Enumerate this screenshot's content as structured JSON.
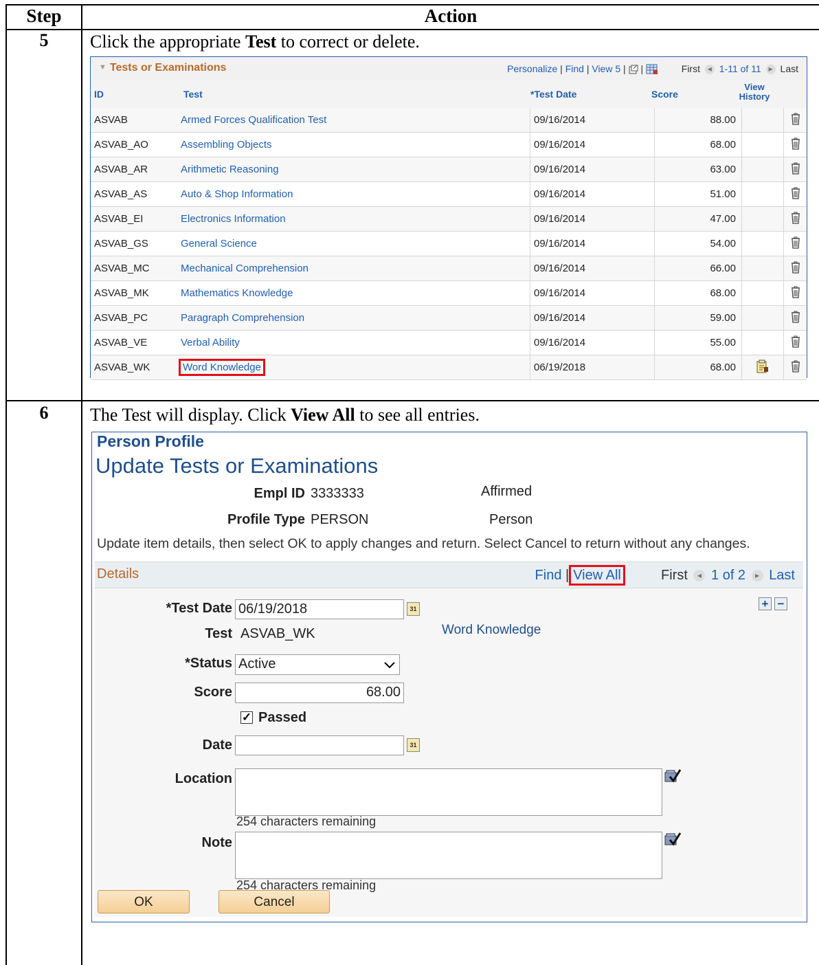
{
  "table": {
    "header_step": "Step",
    "header_action": "Action",
    "step5": {
      "number": "5",
      "instruction_pre": "Click the appropriate ",
      "instruction_bold": "Test",
      "instruction_post": " to correct or delete."
    },
    "step6": {
      "number": "6",
      "instruction_pre": "The Test will display. Click ",
      "instruction_bold": "View All",
      "instruction_post": " to see all entries."
    }
  },
  "grid": {
    "title": "Tests or Examinations",
    "nav": {
      "personalize": "Personalize",
      "find": "Find",
      "view": "View 5",
      "first": "First",
      "range": "1-11 of 11",
      "last": "Last"
    },
    "columns": {
      "id": "ID",
      "test": "Test",
      "date": "*Test Date",
      "score": "Score",
      "history": "View History"
    },
    "rows": [
      {
        "id": "ASVAB",
        "test": "Armed Forces Qualification Test",
        "date": "09/16/2014",
        "score": "88.00",
        "history": false
      },
      {
        "id": "ASVAB_AO",
        "test": "Assembling Objects",
        "date": "09/16/2014",
        "score": "68.00",
        "history": false
      },
      {
        "id": "ASVAB_AR",
        "test": "Arithmetic Reasoning",
        "date": "09/16/2014",
        "score": "63.00",
        "history": false
      },
      {
        "id": "ASVAB_AS",
        "test": "Auto & Shop Information",
        "date": "09/16/2014",
        "score": "51.00",
        "history": false
      },
      {
        "id": "ASVAB_EI",
        "test": "Electronics Information",
        "date": "09/16/2014",
        "score": "47.00",
        "history": false
      },
      {
        "id": "ASVAB_GS",
        "test": "General Science",
        "date": "09/16/2014",
        "score": "54.00",
        "history": false
      },
      {
        "id": "ASVAB_MC",
        "test": "Mechanical Comprehension",
        "date": "09/16/2014",
        "score": "66.00",
        "history": false
      },
      {
        "id": "ASVAB_MK",
        "test": "Mathematics Knowledge",
        "date": "09/16/2014",
        "score": "68.00",
        "history": false
      },
      {
        "id": "ASVAB_PC",
        "test": "Paragraph Comprehension",
        "date": "09/16/2014",
        "score": "59.00",
        "history": false
      },
      {
        "id": "ASVAB_VE",
        "test": "Verbal Ability",
        "date": "09/16/2014",
        "score": "55.00",
        "history": false
      },
      {
        "id": "ASVAB_WK",
        "test": "Word Knowledge",
        "date": "06/19/2018",
        "score": "68.00",
        "history": true,
        "highlighted": true
      }
    ]
  },
  "form": {
    "breadcrumb": "Person Profile",
    "title": "Update Tests or Examinations",
    "empl_id_label": "Empl ID",
    "empl_id_value": "3333333",
    "empl_status": "Affirmed",
    "profile_type_label": "Profile Type",
    "profile_type_value": "PERSON",
    "profile_type_desc": "Person",
    "description": "Update item details, then select OK to apply changes and return. Select Cancel to return without any changes.",
    "details": {
      "title": "Details",
      "find": "Find",
      "view_all": "View All",
      "first": "First",
      "range": "1 of 2",
      "last": "Last"
    },
    "fields": {
      "test_date_label": "*Test Date",
      "test_date_value": "06/19/2018",
      "test_label": "Test",
      "test_value": "ASVAB_WK",
      "test_desc": "Word Knowledge",
      "status_label": "*Status",
      "status_value": "Active",
      "score_label": "Score",
      "score_value": "68.00",
      "passed_label": "Passed",
      "passed_checked": true,
      "date_label": "Date",
      "date_value": "",
      "location_label": "Location",
      "location_value": "",
      "location_remaining": "254 characters remaining",
      "note_label": "Note",
      "note_value": "",
      "note_remaining": "254 characters remaining"
    },
    "buttons": {
      "ok": "OK",
      "cancel": "Cancel"
    }
  },
  "colors": {
    "link": "#1f5fb0",
    "heading": "#1f4e8c",
    "section_title": "#b86a2a",
    "highlight": "#e0101a"
  }
}
